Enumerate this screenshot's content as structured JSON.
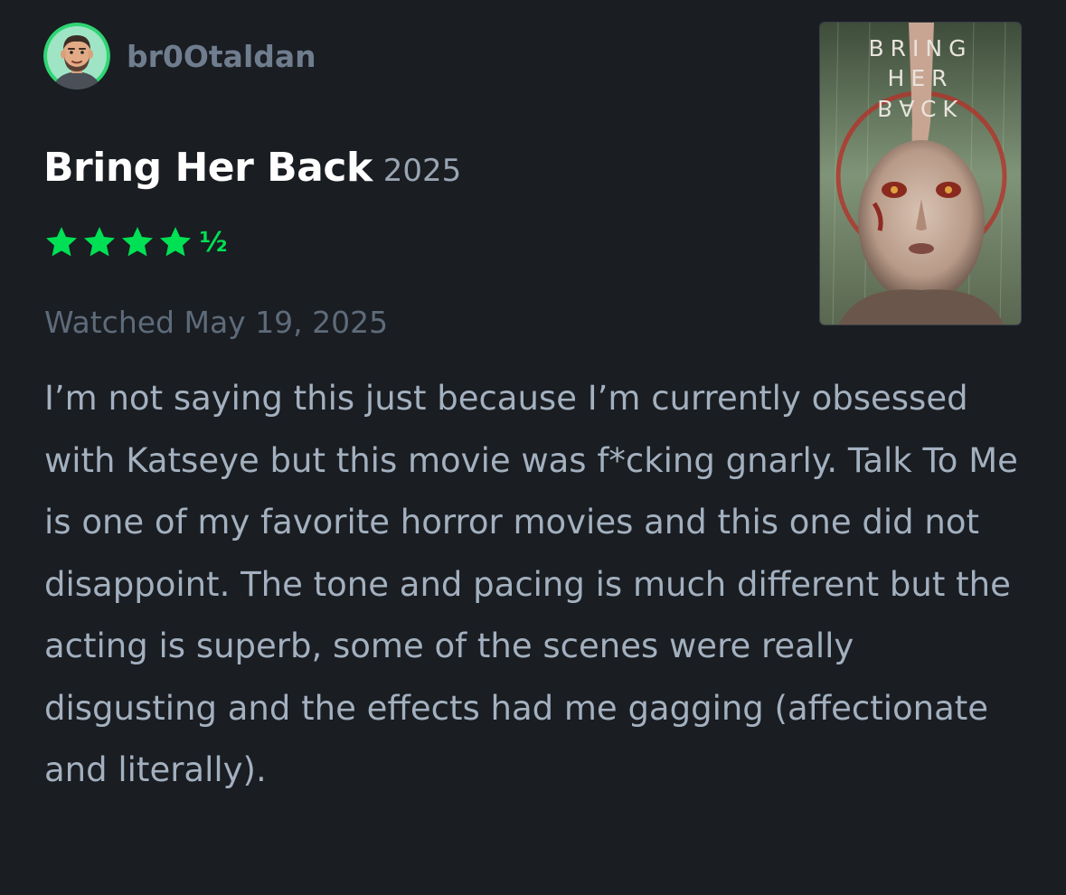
{
  "review": {
    "username": "br0Otaldan",
    "film_title": "Bring Her Back",
    "film_year": "2025",
    "rating": {
      "stars": 4.5,
      "max": 5,
      "half_glyph": "½",
      "color": "#00e054"
    },
    "watched_label": "Watched May 19, 2025",
    "body": "I’m not saying this just because I’m currently obsessed with Katseye but this movie was f*cking gnarly. Talk To Me is one of my favorite horror movies and this one did not disappoint. The tone and pacing is much different but the acting is superb, some of the scenes were really disgusting and the effects had me gagging (affectionate and literally).",
    "poster": {
      "line1": "BRING",
      "line2": "HER",
      "line3": "BACK"
    }
  },
  "colors": {
    "background": "#1a1d22",
    "title": "#ffffff",
    "username": "#6f7d8e",
    "body_text": "#a3b0bf",
    "muted": "#5e6b7a",
    "avatar_ring": "#2ed573"
  },
  "icons": {
    "avatar": "user-avatar-cartoon",
    "star": "star-icon",
    "half_star": "half-star-glyph"
  }
}
